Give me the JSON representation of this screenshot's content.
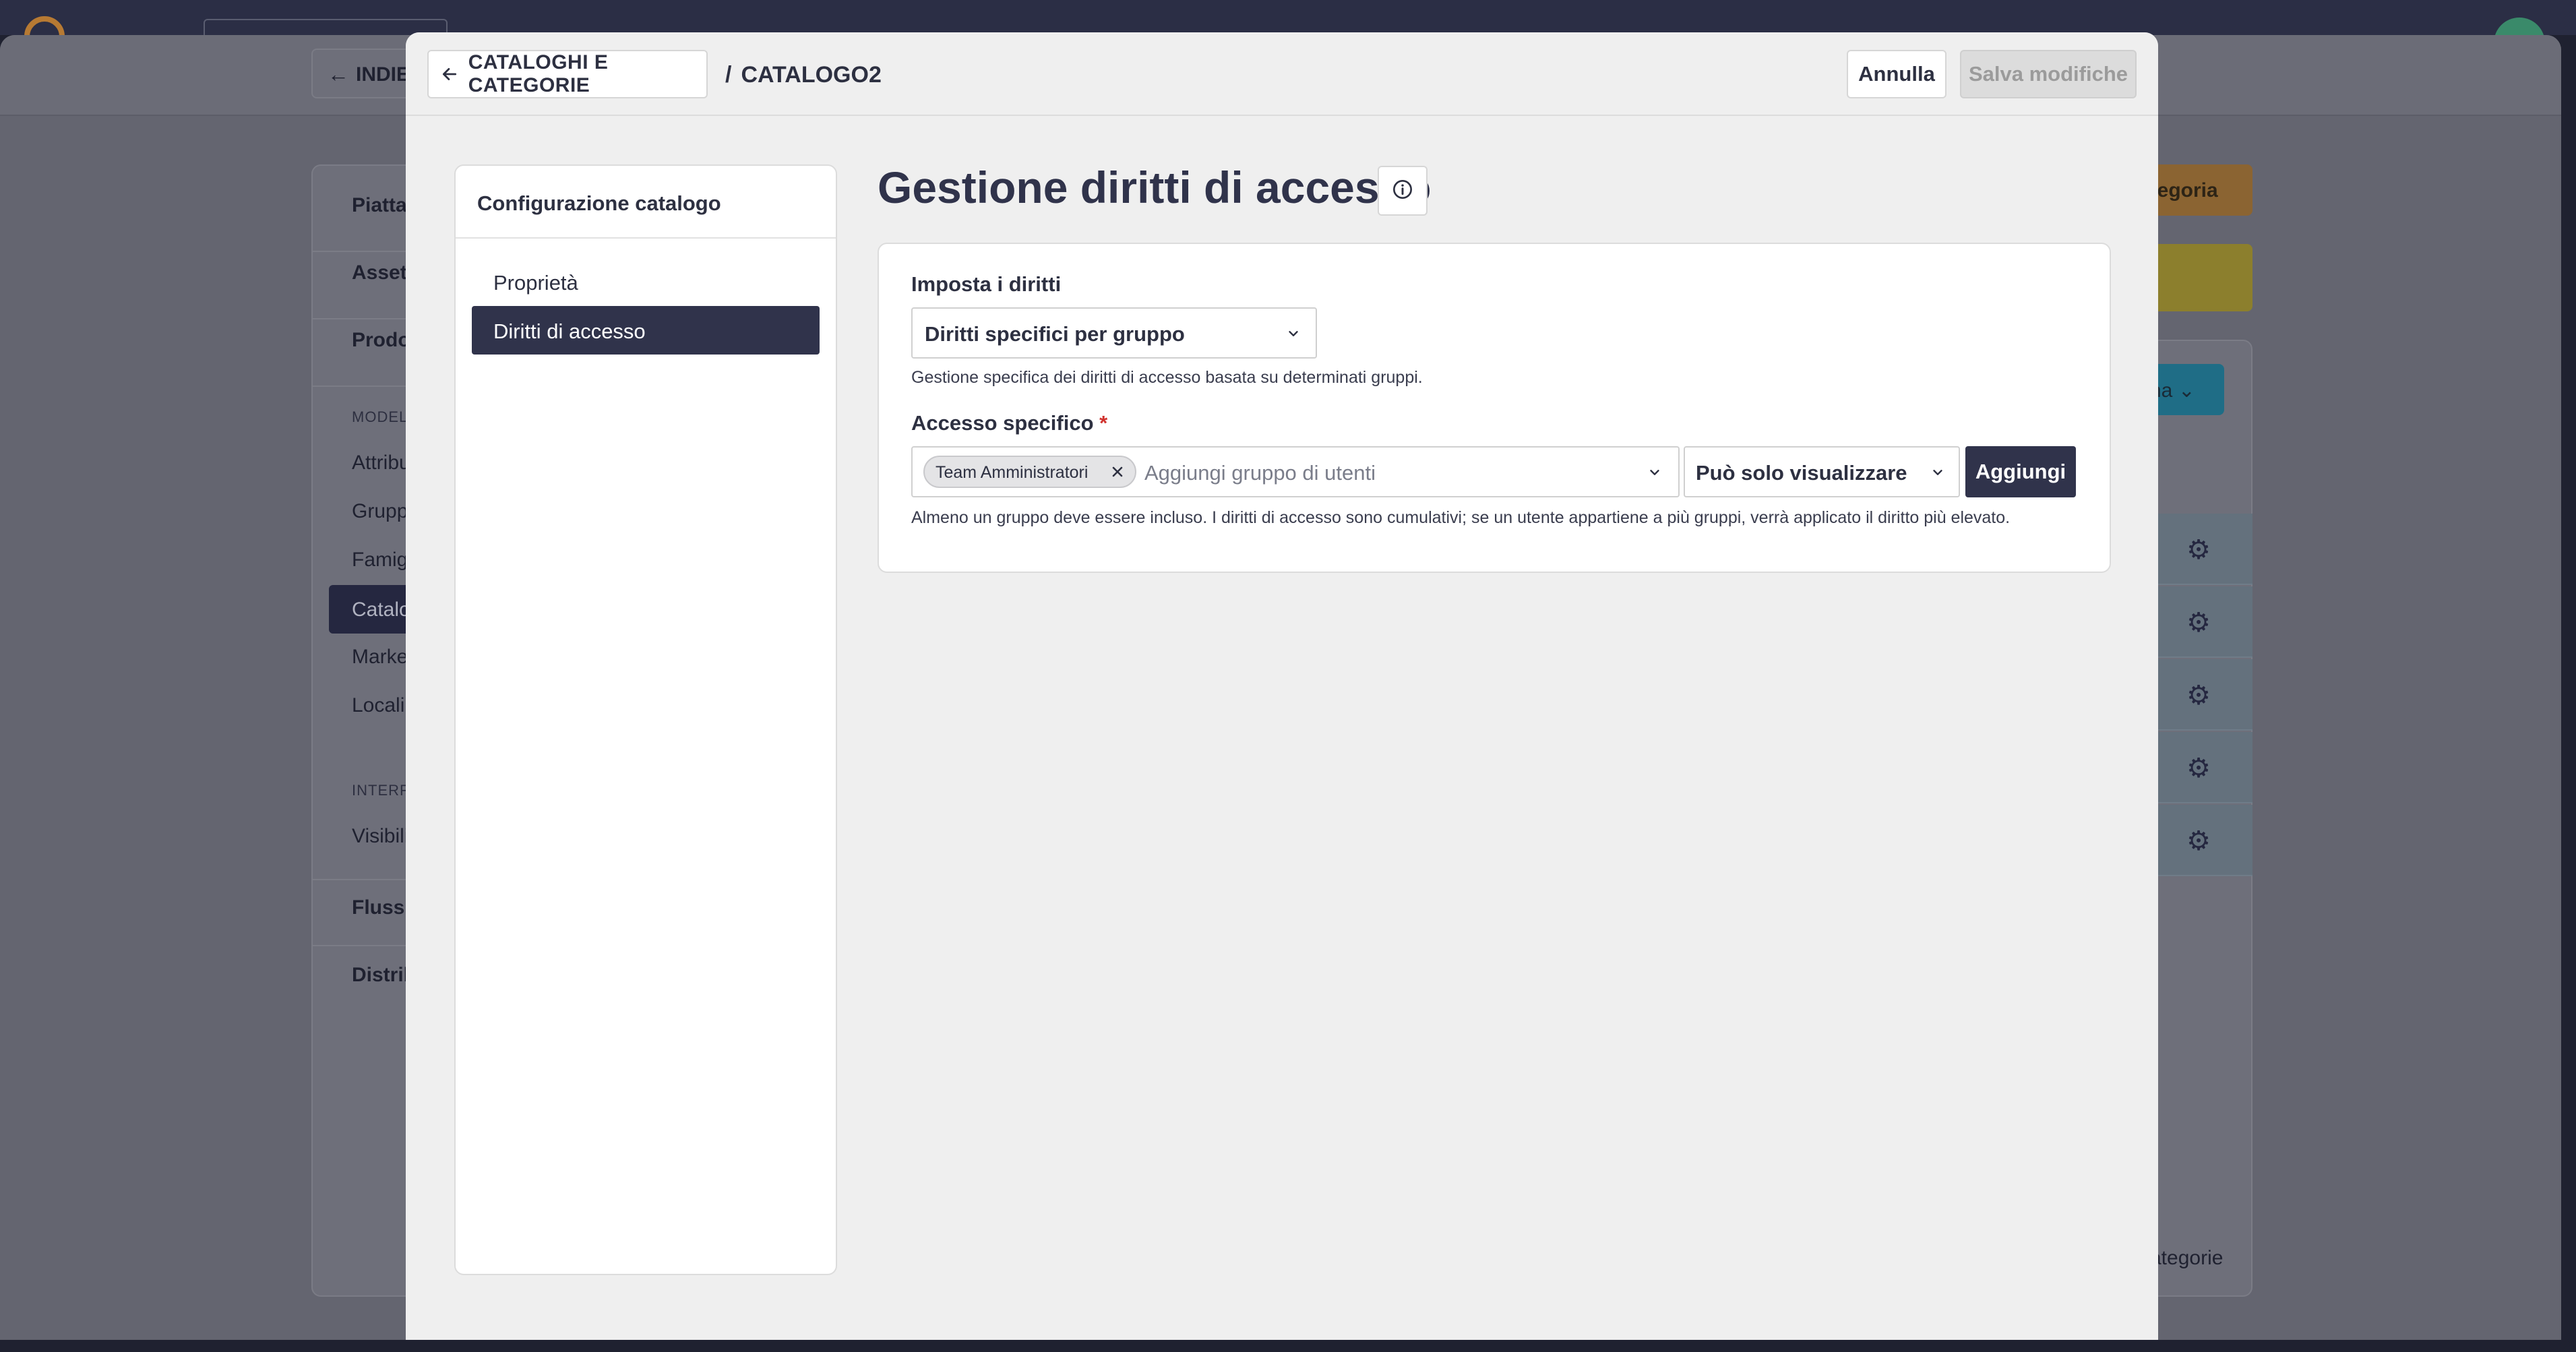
{
  "background": {
    "back_label": "INDIET",
    "sidebar": {
      "items": [
        "Piatta",
        "Asset",
        "Prodo"
      ],
      "section1": "MODEL",
      "subitems": [
        "Attribu",
        "Grupp",
        "Famig",
        "Catalo",
        "Marke",
        "Locali"
      ],
      "section2": "INTERF",
      "subitems2": [
        "Visibili"
      ],
      "items2": [
        "Flussi",
        "Distrib"
      ]
    },
    "category_button": "ategoria",
    "blue_button": "na",
    "footer_text": "ategorie"
  },
  "modal": {
    "back_button": "CATALOGHI E CATEGORIE",
    "breadcrumb_sep": "/",
    "breadcrumb_current": "CATALOGO2",
    "cancel_button": "Annulla",
    "save_button": "Salva modifiche",
    "side_panel": {
      "title": "Configurazione catalogo",
      "items": [
        {
          "label": "Proprietà",
          "active": false
        },
        {
          "label": "Diritti di accesso",
          "active": true
        }
      ]
    },
    "page_title": "Gestione diritti di accesso",
    "rights": {
      "label": "Imposta i diritti",
      "selected": "Diritti specifici per gruppo",
      "help": "Gestione specifica dei diritti di accesso basata su determinati gruppi."
    },
    "specific_access": {
      "label": "Accesso specifico",
      "required_mark": "*",
      "chips": [
        "Team Amministratori"
      ],
      "placeholder": "Aggiungi gruppo di utenti",
      "permission_selected": "Può solo visualizzare",
      "add_button": "Aggiungi",
      "help": "Almeno un gruppo deve essere incluso. I diritti di accesso sono cumulativi; se un utente appartiene a più gruppi, verrà applicato il diritto più elevato."
    }
  },
  "colors": {
    "primary_dark": "#30334b",
    "required": "#d0312d",
    "disabled_bg": "#dcdcdc"
  }
}
